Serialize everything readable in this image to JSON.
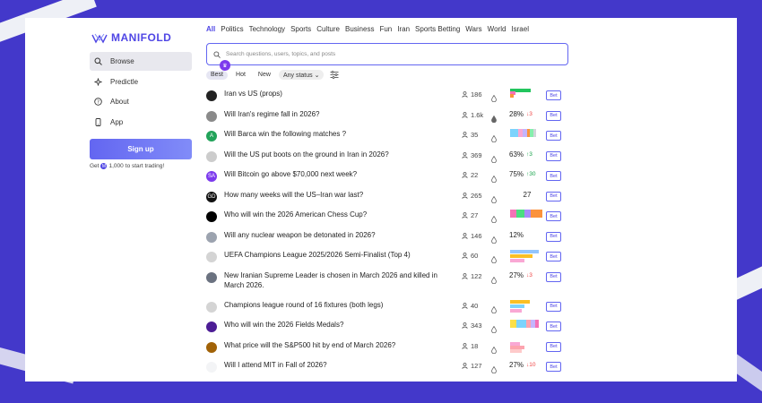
{
  "app": {
    "name": "MANIFOLD"
  },
  "sidebar": {
    "items": [
      {
        "label": "Browse",
        "icon": "search-icon",
        "active": true
      },
      {
        "label": "Predictle",
        "icon": "sparkle-icon",
        "active": false
      },
      {
        "label": "About",
        "icon": "question-icon",
        "active": false
      },
      {
        "label": "App",
        "icon": "phone-icon",
        "active": false
      }
    ],
    "signup_label": "Sign up",
    "promo_prefix": "Get",
    "promo_amount": "1,000",
    "promo_suffix": "to start trading!"
  },
  "topics": [
    "All",
    "Politics",
    "Technology",
    "Sports",
    "Culture",
    "Business",
    "Fun",
    "Iran",
    "Sports Betting",
    "Wars",
    "World",
    "Israel"
  ],
  "search": {
    "placeholder": "Search questions, users, topics, and posts"
  },
  "sort": {
    "options": [
      "Best",
      "Hot",
      "New"
    ],
    "active": "Best",
    "status_label": "Any status"
  },
  "colors": {
    "accent": "#4f46e5",
    "up": "#16a34a",
    "down": "#ef4444"
  },
  "markets": [
    {
      "question": "Iran vs US (props)",
      "traders": "186",
      "kind": "multi",
      "avatar_color": "#222222",
      "avatar_text": "",
      "bars": [
        [
          "#22c55e",
          0.65,
          1
        ],
        [
          "#f472b6",
          0.18,
          4
        ],
        [
          "#fb923c",
          0.12,
          7
        ]
      ]
    },
    {
      "question": "Will Iran's regime fall in 2026?",
      "traders": "1.6k",
      "kind": "binary",
      "prob": "28%",
      "change": "3",
      "dir": "down",
      "avatar_color": "#8a8a8a",
      "avatar_text": ""
    },
    {
      "question": "Will Barca win the following matches ?",
      "traders": "35",
      "kind": "multi",
      "avatar_color": "#22a35a",
      "avatar_text": "A",
      "bars": [
        [
          "#7dd3fc",
          0.25,
          1
        ],
        [
          "#f9a8d4",
          0.15,
          1
        ],
        [
          "#c4b5fd",
          0.12,
          1
        ],
        [
          "#fb923c",
          0.1,
          1
        ],
        [
          "#86efac",
          0.1,
          1
        ],
        [
          "#d1d5db",
          0.08,
          1
        ]
      ]
    },
    {
      "question": "Will the US put boots on the ground in Iran in 2026?",
      "traders": "369",
      "kind": "binary",
      "prob": "63%",
      "change": "3",
      "dir": "up",
      "avatar_color": "#cccccc",
      "avatar_text": ""
    },
    {
      "question": "Will Bitcoin go above $70,000 next week?",
      "traders": "22",
      "kind": "binary",
      "prob": "75%",
      "change": "30",
      "dir": "up",
      "avatar_color": "#7c3aed",
      "avatar_text": "SA"
    },
    {
      "question": "How many weeks will the US–Iran war last?",
      "traders": "265",
      "kind": "numeric",
      "prob": "27",
      "avatar_color": "#111111",
      "avatar_text": "GD"
    },
    {
      "question": "Who will win the 2026 American Chess Cup?",
      "traders": "27",
      "kind": "multi",
      "avatar_color": "#000000",
      "avatar_text": "",
      "bars": [
        [
          "#f472b6",
          0.2,
          1
        ],
        [
          "#4ade80",
          0.25,
          1
        ],
        [
          "#a78bfa",
          0.2,
          1
        ],
        [
          "#fb923c",
          0.35,
          1
        ]
      ]
    },
    {
      "question": "Will any nuclear weapon be detonated in 2026?",
      "traders": "146",
      "kind": "binary",
      "prob": "12%",
      "avatar_color": "#9ca3af",
      "avatar_text": ""
    },
    {
      "question": "UEFA Champions League 2025/2026 Semi-Finalist (Top 4)",
      "traders": "60",
      "kind": "multi",
      "avatar_color": "#d4d4d4",
      "avatar_text": "",
      "bars": [
        [
          "#93c5fd",
          0.9,
          1
        ],
        [
          "#fbbf24",
          0.7,
          6
        ],
        [
          "#f9a8d4",
          0.45,
          11
        ]
      ]
    },
    {
      "question": "New Iranian Supreme Leader is chosen in March 2026 and killed in March 2026.",
      "traders": "122",
      "kind": "binary",
      "prob": "27%",
      "change": "3",
      "dir": "down",
      "avatar_color": "#6b7280",
      "avatar_text": "",
      "tall": true
    },
    {
      "question": "Champions league round of 16 fixtures (both legs)",
      "traders": "40",
      "kind": "multi",
      "avatar_color": "#d4d4d4",
      "avatar_text": "",
      "bars": [
        [
          "#fbbf24",
          0.62,
          1
        ],
        [
          "#7dd3fc",
          0.45,
          6
        ],
        [
          "#f9a8d4",
          0.35,
          11
        ]
      ]
    },
    {
      "question": "Who will win the 2026 Fields Medals?",
      "traders": "343",
      "kind": "multi",
      "avatar_color": "#4c1d95",
      "avatar_text": "",
      "bars": [
        [
          "#fde047",
          0.2,
          1
        ],
        [
          "#7dd3fc",
          0.3,
          1
        ],
        [
          "#fda4af",
          0.15,
          1
        ],
        [
          "#c4b5fd",
          0.12,
          1
        ],
        [
          "#f472b6",
          0.12,
          1
        ]
      ]
    },
    {
      "question": "What price will the S&P500 hit by end of March 2026?",
      "traders": "18",
      "kind": "multi",
      "avatar_color": "#a16207",
      "avatar_text": "",
      "bars": [
        [
          "#f9a8d4",
          0.3,
          3
        ],
        [
          "#fda4af",
          0.45,
          7
        ],
        [
          "#fecaca",
          0.35,
          11
        ]
      ]
    },
    {
      "question": "Will I attend MIT in Fall of 2026?",
      "traders": "127",
      "kind": "binary",
      "prob": "27%",
      "change": "10",
      "dir": "down",
      "avatar_color": "#f3f4f6",
      "avatar_text": ""
    },
    {
      "question": "",
      "traders": "",
      "kind": "multi",
      "avatar_color": "#888888",
      "avatar_text": "",
      "bars": [
        [
          "#fca5a5",
          0.4,
          6
        ],
        [
          "#f9a8d4",
          0.3,
          11
        ]
      ],
      "hidden": true
    }
  ],
  "bet_label": "Bet",
  "numeric_icon": "drop-filled-icon"
}
